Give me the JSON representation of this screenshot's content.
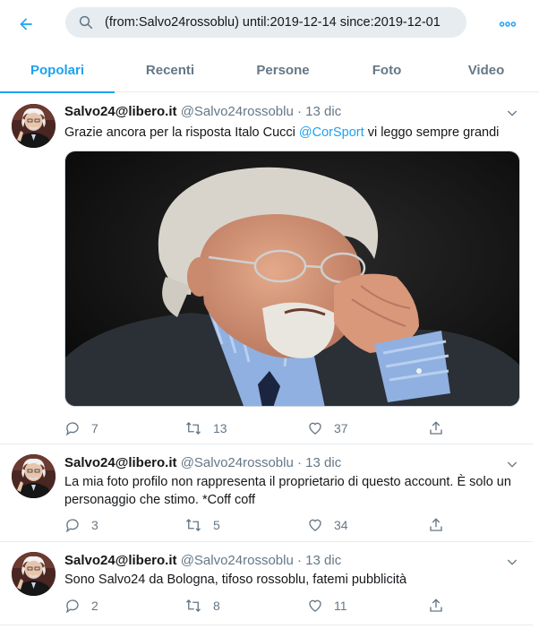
{
  "search": {
    "query": "(from:Salvo24rossoblu) until:2019-12-14 since:2019-12-01"
  },
  "icons": {
    "back": "arrow-left-icon",
    "search": "search-icon",
    "more": "more-dots-icon"
  },
  "colors": {
    "accent": "#1da1f2",
    "secondary_text": "#657786",
    "search_bg": "#e6ecf0"
  },
  "tabs": [
    {
      "label": "Popolari",
      "active": true
    },
    {
      "label": "Recenti",
      "active": false
    },
    {
      "label": "Persone",
      "active": false
    },
    {
      "label": "Foto",
      "active": false
    },
    {
      "label": "Video",
      "active": false
    }
  ],
  "tweets": [
    {
      "name": "Salvo24@libero.it",
      "handle": "@Salvo24rossoblu",
      "separator": "·",
      "date": "13 dic",
      "text_before": "Grazie ancora per la risposta Italo Cucci ",
      "mention": "@CorSport",
      "text_after": " vi leggo sempre grandi",
      "replies": "7",
      "retweets": "13",
      "likes": "37"
    },
    {
      "name": "Salvo24@libero.it",
      "handle": "@Salvo24rossoblu",
      "separator": "·",
      "date": "13 dic",
      "text": "La mia foto profilo non rappresenta il proprietario di questo account. È solo un personaggio che stimo. *Coff coff",
      "replies": "3",
      "retweets": "5",
      "likes": "34"
    },
    {
      "name": "Salvo24@libero.it",
      "handle": "@Salvo24rossoblu",
      "separator": "·",
      "date": "13 dic",
      "text": "Sono Salvo24 da Bologna, tifoso rossoblu, fatemi pubblicità",
      "replies": "2",
      "retweets": "8",
      "likes": "11"
    }
  ]
}
